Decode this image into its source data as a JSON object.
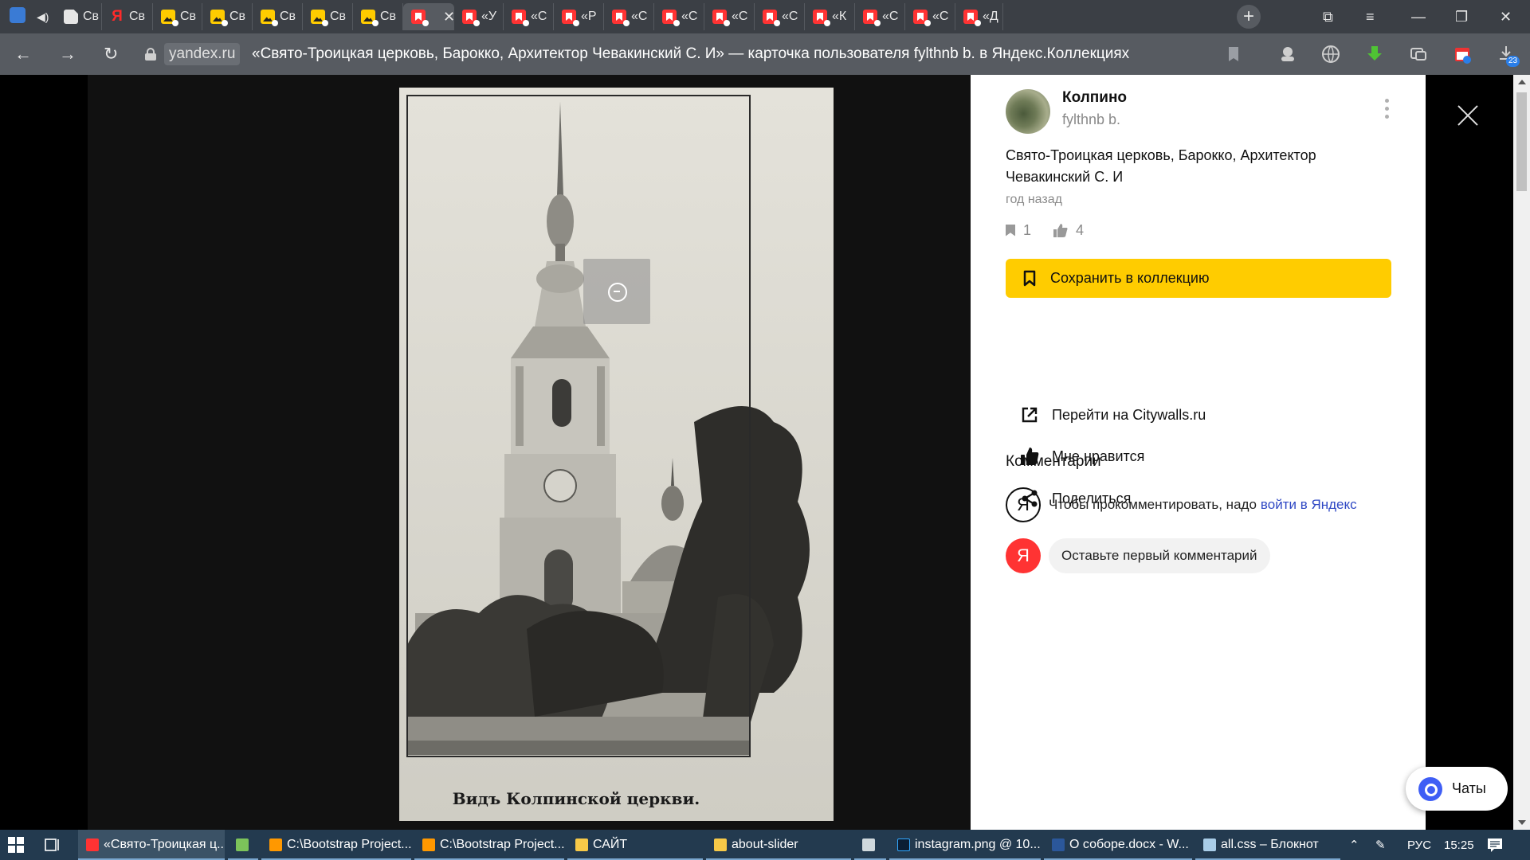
{
  "browser": {
    "tabs": [
      {
        "label": "Св",
        "icon": "doc"
      },
      {
        "label": "Св",
        "icon": "yandex"
      },
      {
        "label": "Св",
        "icon": "images"
      },
      {
        "label": "Св",
        "icon": "images"
      },
      {
        "label": "Св",
        "icon": "images"
      },
      {
        "label": "Св",
        "icon": "images"
      },
      {
        "label": "Св",
        "icon": "images"
      },
      {
        "label": "",
        "icon": "collections",
        "active": true
      },
      {
        "label": "«У",
        "icon": "collections"
      },
      {
        "label": "«С",
        "icon": "collections"
      },
      {
        "label": "«Р",
        "icon": "collections"
      },
      {
        "label": "«С",
        "icon": "collections"
      },
      {
        "label": "«С",
        "icon": "collections"
      },
      {
        "label": "«С",
        "icon": "collections"
      },
      {
        "label": "«С",
        "icon": "collections"
      },
      {
        "label": "«К",
        "icon": "collections"
      },
      {
        "label": "«С",
        "icon": "collections"
      },
      {
        "label": "«С",
        "icon": "collections"
      },
      {
        "label": "«Д",
        "icon": "collections"
      }
    ],
    "domain": "yandex.ru",
    "page_title": "«Свято-Троицкая церковь, Барокко, Архитектор Чевакинский С. И» — карточка пользователя fylthnb b. в Яндекс.Коллекциях",
    "downloads_badge": "23"
  },
  "card": {
    "collection_name": "Колпино",
    "author_login": "fylthnb b.",
    "title": "Свято-Троицкая церковь, Барокко, Архитектор Чевакинский С. И",
    "time": "год назад",
    "bookmarks_count": "1",
    "likes_count": "4",
    "save_button": "Сохранить в коллекцию",
    "goto_link": "Перейти на Citywalls.ru",
    "like_action": "Мне нравится",
    "share_action": "Поделиться",
    "comments_title": "Комментарии",
    "login_prompt": "Чтобы прокомментировать, надо",
    "login_link": "войти в Яндекс",
    "comment_placeholder": "Оставьте первый комментарий",
    "yandex_letter": "Я",
    "photo_caption": "Видъ Колпинской церкви.",
    "chats_label": "Чаты"
  },
  "taskbar": {
    "items": [
      {
        "label": "«Свято-Троицкая ц...",
        "icon": "yandex-browser",
        "active": true
      },
      {
        "label": "",
        "icon": "notepad-plus"
      },
      {
        "label": "C:\\Bootstrap Project...",
        "icon": "sublime-text"
      },
      {
        "label": "C:\\Bootstrap Project...",
        "icon": "sublime-text"
      },
      {
        "label": "САЙТ",
        "icon": "folder"
      },
      {
        "label": "about-slider",
        "icon": "folder"
      },
      {
        "label": "",
        "icon": "calculator"
      },
      {
        "label": "instagram.png @ 10...",
        "icon": "photoshop"
      },
      {
        "label": "О соборе.docx - W...",
        "icon": "word"
      },
      {
        "label": "all.css – Блокнот",
        "icon": "notepad"
      }
    ],
    "language": "РУС",
    "time": "15:25"
  },
  "colors": {
    "accent_yellow": "#ffcc00",
    "link_blue": "#2f48c4",
    "yandex_red": "#ff3333",
    "tabbar": "#3b3f45",
    "addressbar": "#575b61",
    "taskbar": "#233a4f"
  }
}
